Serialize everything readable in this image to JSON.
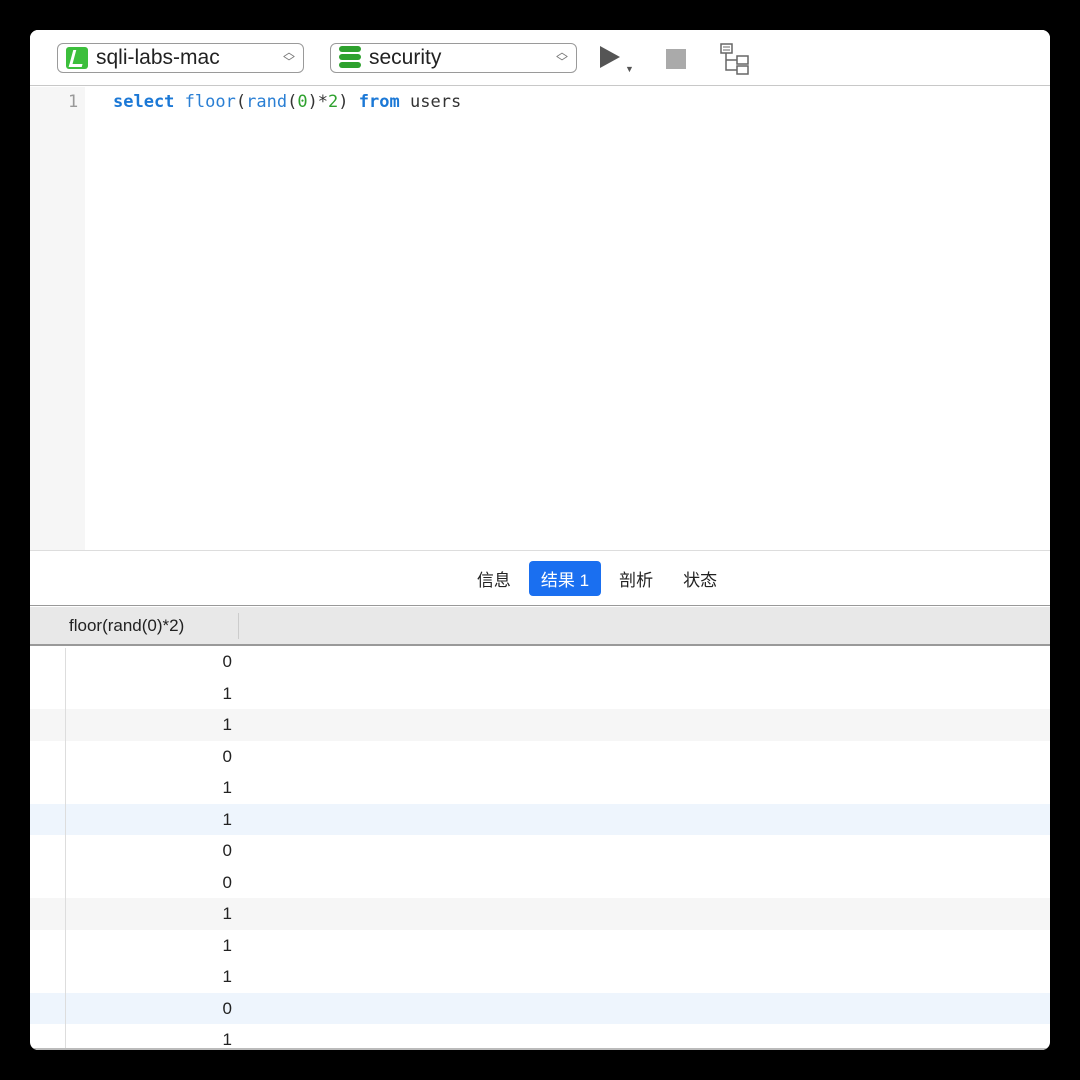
{
  "toolbar": {
    "connection": "sqli-labs-mac",
    "database": "security",
    "icons": [
      "connection-icon",
      "database-icon",
      "run-icon",
      "stop-icon",
      "explain-icon"
    ]
  },
  "editor": {
    "line_number": "1",
    "query": {
      "select": "select",
      "floor": "floor",
      "p1": "(",
      "rand": "rand",
      "p2": "(",
      "zero": "0",
      "p3": ")*",
      "two": "2",
      "p4": ")",
      "from": "from",
      "users": "users"
    }
  },
  "tabs": [
    {
      "label": "信息"
    },
    {
      "label": "结果 1",
      "active": true
    },
    {
      "label": "剖析"
    },
    {
      "label": "状态"
    }
  ],
  "grid": {
    "column": "floor(rand(0)*2)",
    "rows": [
      "0",
      "1",
      "1",
      "0",
      "1",
      "1",
      "0",
      "0",
      "1",
      "1",
      "1",
      "0",
      "1"
    ]
  }
}
